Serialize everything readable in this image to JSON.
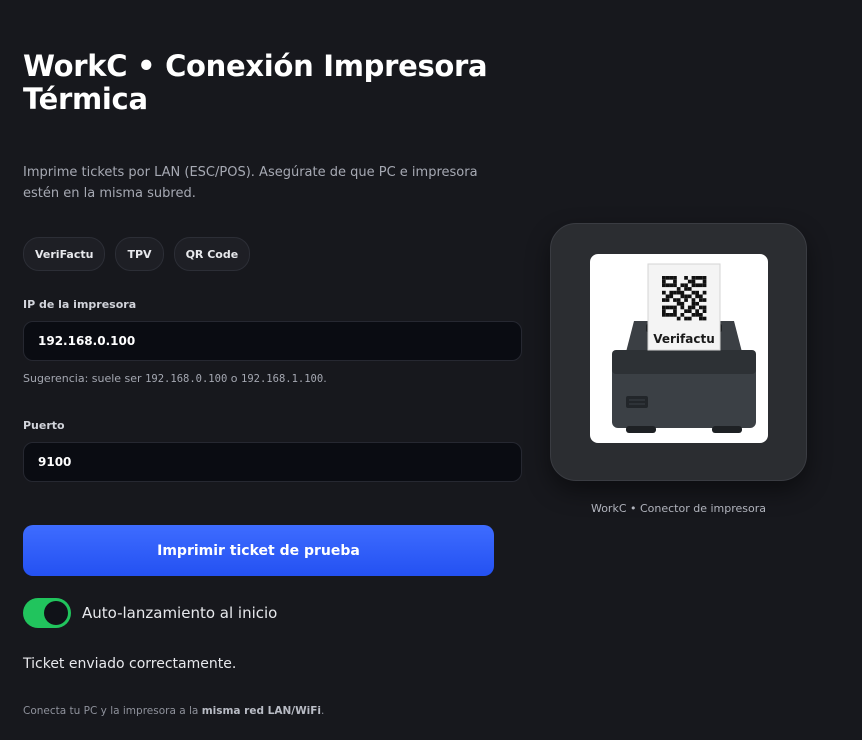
{
  "header": {
    "title": "WorkC • Conexión Impresora Térmica",
    "subtitle": "Imprime tickets por LAN (ESC/POS). Asegúrate de que PC e impresora estén en la misma subred."
  },
  "chips": [
    "VeriFactu",
    "TPV",
    "QR Code"
  ],
  "ip_field": {
    "label": "IP de la impresora",
    "value": "192.168.0.100",
    "hint_prefix": "Sugerencia: suele ser ",
    "hint_ip_1": "192.168.0.100",
    "hint_middle": " o ",
    "hint_ip_2": "192.168.1.100",
    "hint_suffix": "."
  },
  "port_field": {
    "label": "Puerto",
    "value": "9100"
  },
  "actions": {
    "print_button_label": "Imprimir ticket de prueba"
  },
  "autolaunch": {
    "label": "Auto-lanzamiento al inicio",
    "enabled": true
  },
  "status_message": "Ticket enviado correctamente.",
  "footer": {
    "prefix": "Conecta tu PC y la impresora a la ",
    "bold": "misma red LAN/WiFi",
    "suffix": "."
  },
  "illustration": {
    "ticket_text": "Verifactu",
    "caption": "WorkC • Conector de impresora"
  },
  "colors": {
    "background": "#17181d",
    "accent": "#2f5bff",
    "toggle_on": "#21c45d"
  }
}
